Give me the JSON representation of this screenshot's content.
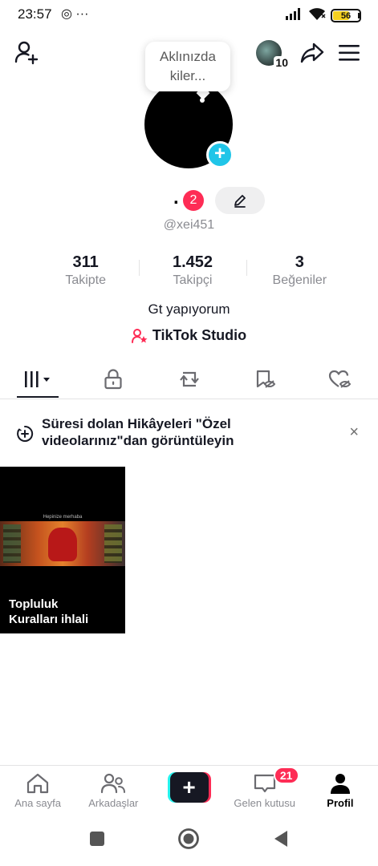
{
  "status_bar": {
    "time": "23:57",
    "left_icons": "◎ ···",
    "battery_level": "56"
  },
  "header": {
    "tooltip": "Aklınızda kiler...",
    "avatar_count": "10"
  },
  "profile": {
    "display_name": ".",
    "name_badge": "2",
    "username": "@xei451",
    "bio": "Gt yapıyorum",
    "studio_label": "TikTok Studio"
  },
  "stats": [
    {
      "value": "311",
      "label": "Takipte"
    },
    {
      "value": "1.452",
      "label": "Takipçi"
    },
    {
      "value": "3",
      "label": "Beğeniler"
    }
  ],
  "notice": {
    "text": "Süresi dolan Hikâyeleri \"Özel videolarınız\"dan görüntüleyin",
    "close": "×"
  },
  "videos": [
    {
      "caption_line1": "Topluluk",
      "caption_line2": "Kuralları ihlali",
      "thumb_text": "Hepinize merhaba"
    }
  ],
  "bottom_nav": {
    "home": "Ana sayfa",
    "friends": "Arkadaşlar",
    "create": "+",
    "inbox": "Gelen kutusu",
    "inbox_badge": "21",
    "profile": "Profil"
  },
  "colors": {
    "accent_red": "#fe2c55",
    "accent_cyan": "#25f4ee",
    "plus_blue": "#20c5e8",
    "battery_yellow": "#f5d020"
  }
}
